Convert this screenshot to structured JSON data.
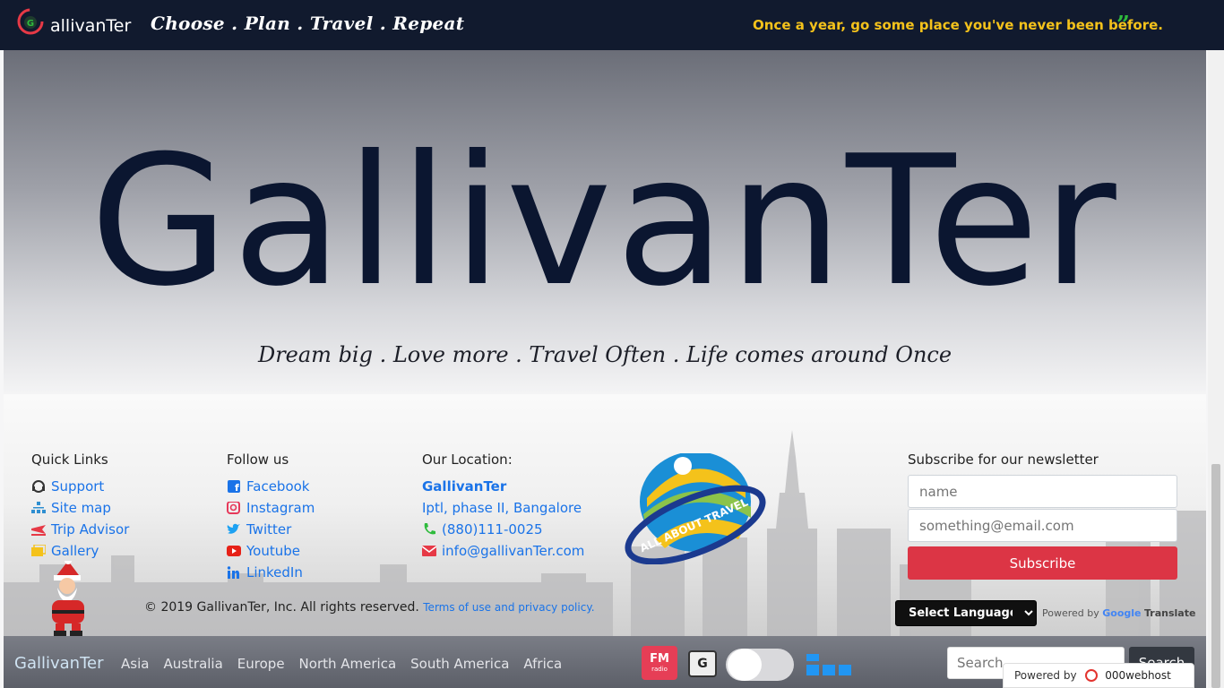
{
  "header": {
    "brand": "allivanTer",
    "tagline": "Choose . Plan . Travel . Repeat",
    "quote": "Once a year, go some place you've never been before.",
    "quote_icon": "quote-right-icon"
  },
  "hero": {
    "title": "GallivanTer",
    "subtitle": "Dream big . Love more . Travel Often . Life comes around Once"
  },
  "footer": {
    "quick_links": {
      "heading": "Quick Links",
      "items": [
        {
          "label": "Support",
          "icon": "headset-icon"
        },
        {
          "label": "Site map",
          "icon": "sitemap-icon"
        },
        {
          "label": "Trip Advisor",
          "icon": "plane-icon"
        },
        {
          "label": "Gallery",
          "icon": "images-icon"
        }
      ]
    },
    "follow": {
      "heading": "Follow us",
      "items": [
        {
          "label": "Facebook",
          "icon": "facebook-icon"
        },
        {
          "label": "Instagram",
          "icon": "instagram-icon"
        },
        {
          "label": "Twitter",
          "icon": "twitter-icon"
        },
        {
          "label": "Youtube",
          "icon": "youtube-icon"
        },
        {
          "label": "LinkedIn",
          "icon": "linkedin-icon"
        }
      ]
    },
    "location": {
      "heading": "Our Location:",
      "name": "GallivanTer",
      "address": "Iptl, phase II, Bangalore",
      "phone": "(880)111-0025",
      "email": "info@gallivanTer.com"
    },
    "badge_text": "ALL ABOUT TRAVEL",
    "newsletter": {
      "heading": "Subscribe for our newsletter",
      "name_placeholder": "name",
      "email_placeholder": "something@email.com",
      "button": "Subscribe"
    },
    "copyright": "© 2019 GallivanTer, Inc. All rights reserved.",
    "terms": "Terms of use and privacy policy.",
    "language_select": "Select Language",
    "powered_by": "Powered by",
    "google": "Google",
    "translate": "Translate"
  },
  "bottom_nav": {
    "brand": "GallivanTer",
    "links": [
      "Asia",
      "Australia",
      "Europe",
      "North America",
      "South America",
      "Africa"
    ],
    "fm_label": "FM",
    "fm_sub": "radio",
    "search_placeholder": "Search",
    "search_button": "Search"
  },
  "webhost": {
    "powered": "Powered by",
    "name": "000webhost"
  }
}
